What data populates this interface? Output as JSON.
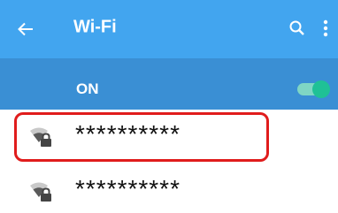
{
  "appbar": {
    "title": "Wi-Fi",
    "back_icon": "arrow-left-icon",
    "search_icon": "search-icon",
    "overflow_icon": "more-vertical-icon",
    "color": "#42a5ef"
  },
  "toggle": {
    "label": "ON",
    "state": true,
    "row_color": "#3a8fd4",
    "accent": "#1fc196"
  },
  "networks": [
    {
      "name": "**********",
      "icon": "wifi-locked-icon"
    },
    {
      "name": "**********",
      "icon": "wifi-locked-icon"
    }
  ],
  "highlight_color": "#e01c1c"
}
